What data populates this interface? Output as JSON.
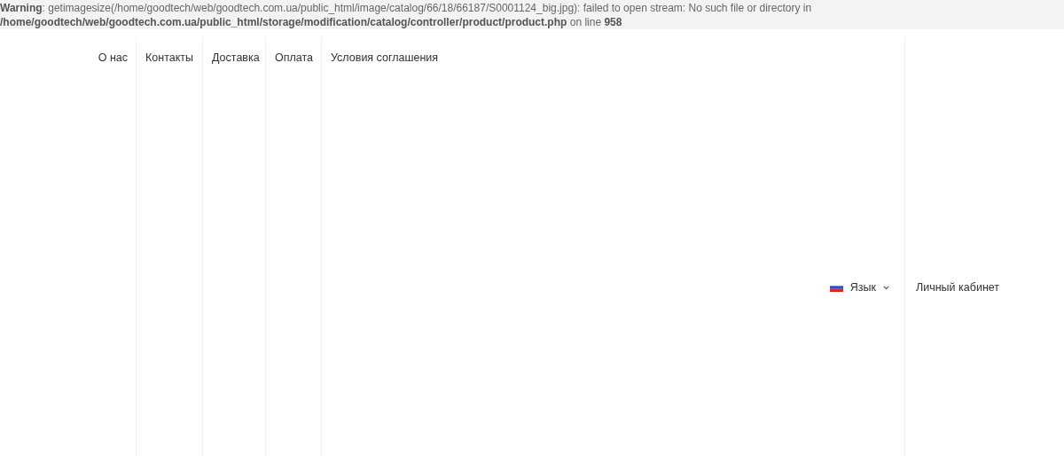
{
  "warning": {
    "lines": [
      "**Warning**: getimagesize(/home/goodtech/web/goodtech.com.ua/public_html/image/catalog/66/18/66187/S0001124_big.jpg): failed to open stream: No such file or directory in",
      "**/home/goodtech/web/goodtech.com.ua/public_html/storage/modification/catalog/controller/product/product.php** on line **958**"
    ]
  },
  "nav": {
    "links": [
      "О нас",
      "Контакты",
      "Доставка",
      "Оплата",
      "Условия соглашения"
    ]
  },
  "language": {
    "label": "Язык"
  },
  "account": {
    "label": "Личный кабинет"
  }
}
